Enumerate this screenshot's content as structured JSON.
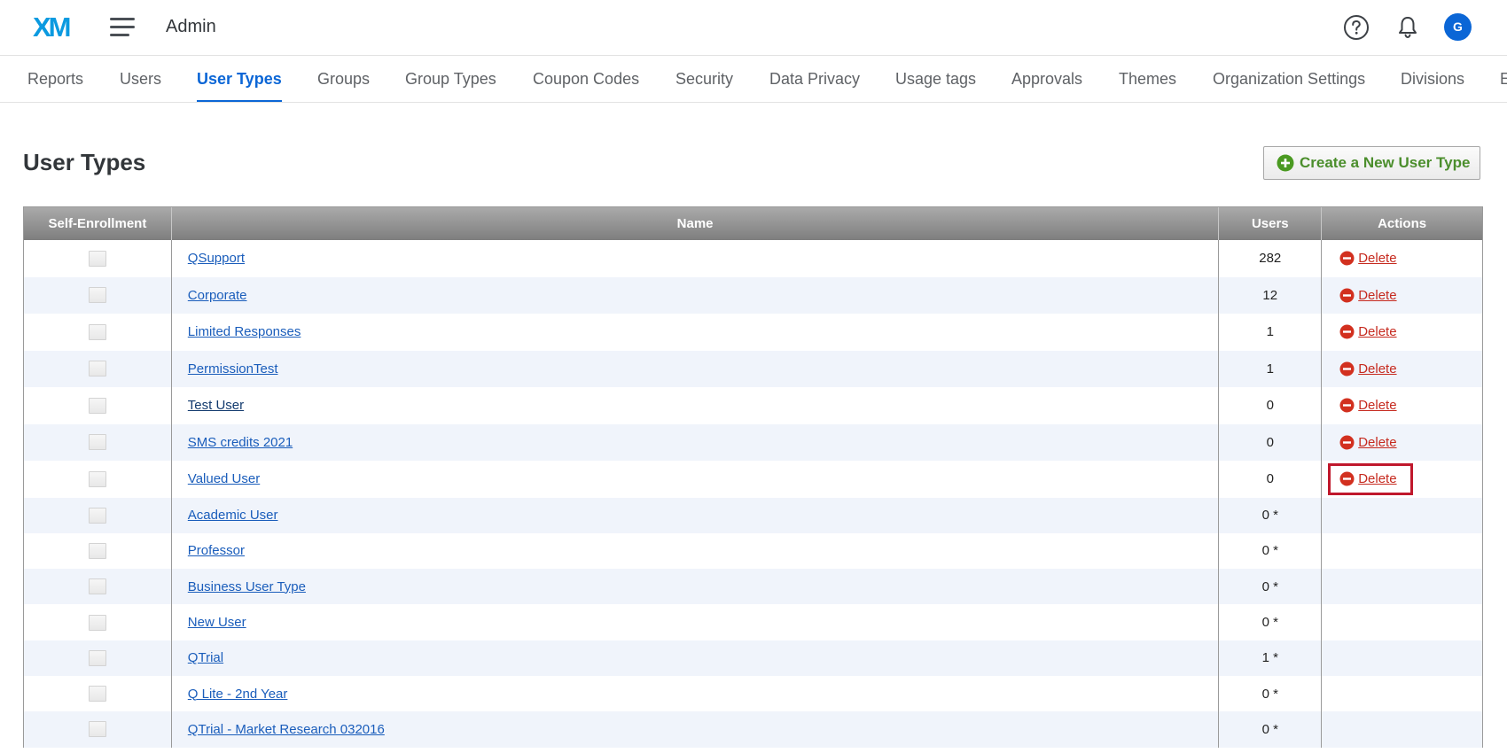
{
  "header": {
    "app_title": "Admin",
    "avatar_initial": "G",
    "logo_text": "XM",
    "brand_color": "#0b66d6"
  },
  "tabs": [
    {
      "label": "Reports",
      "active": false
    },
    {
      "label": "Users",
      "active": false
    },
    {
      "label": "User Types",
      "active": true
    },
    {
      "label": "Groups",
      "active": false
    },
    {
      "label": "Group Types",
      "active": false
    },
    {
      "label": "Coupon Codes",
      "active": false
    },
    {
      "label": "Security",
      "active": false
    },
    {
      "label": "Data Privacy",
      "active": false
    },
    {
      "label": "Usage tags",
      "active": false
    },
    {
      "label": "Approvals",
      "active": false
    },
    {
      "label": "Themes",
      "active": false
    },
    {
      "label": "Organization Settings",
      "active": false
    },
    {
      "label": "Divisions",
      "active": false
    },
    {
      "label": "E",
      "active": false
    }
  ],
  "page": {
    "title": "User Types",
    "create_button_label": "Create a New User Type"
  },
  "table": {
    "columns": [
      "Self-Enrollment",
      "Name",
      "Users",
      "Actions"
    ],
    "rows": [
      {
        "name": "QSupport",
        "users": "282",
        "action": "Delete"
      },
      {
        "name": "Corporate",
        "users": "12",
        "action": "Delete"
      },
      {
        "name": "Limited Responses",
        "users": "1",
        "action": "Delete"
      },
      {
        "name": "PermissionTest",
        "users": "1",
        "action": "Delete"
      },
      {
        "name": "Test User",
        "users": "0",
        "action": "Delete"
      },
      {
        "name": "SMS credits 2021",
        "users": "0",
        "action": "Delete"
      },
      {
        "name": "Valued User",
        "users": "0",
        "action": "Delete",
        "highlighted": true
      },
      {
        "name": "Academic User",
        "users": "0 *",
        "action": ""
      },
      {
        "name": "Professor",
        "users": "0 *",
        "action": ""
      },
      {
        "name": "Business User Type",
        "users": "0 *",
        "action": ""
      },
      {
        "name": "New User",
        "users": "0 *",
        "action": ""
      },
      {
        "name": "QTrial",
        "users": "1 *",
        "action": ""
      },
      {
        "name": "Q Lite - 2nd Year",
        "users": "0 *",
        "action": ""
      },
      {
        "name": "QTrial - Market Research 032016",
        "users": "0 *",
        "action": ""
      }
    ]
  },
  "colors": {
    "link": "#1a5dbb",
    "delete": "#c62a1f",
    "create_button_text": "#4b8e2c",
    "highlight_box": "#c0182c"
  }
}
